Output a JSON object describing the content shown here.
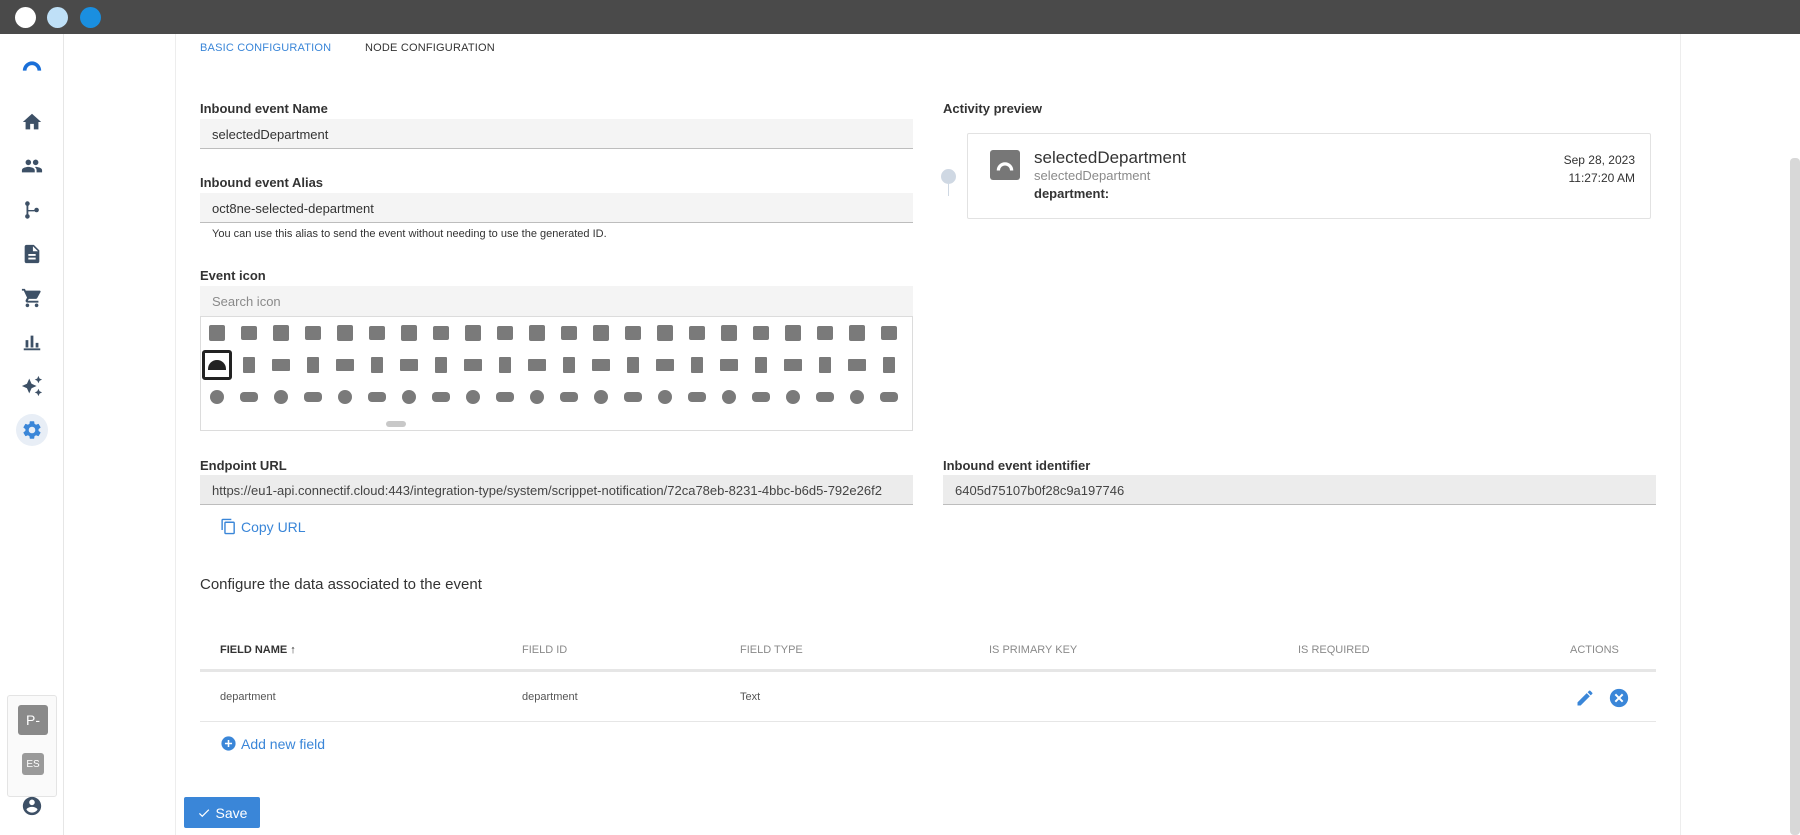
{
  "tabs": [
    {
      "label": "BASIC CONFIGURATION",
      "active": true
    },
    {
      "label": "NODE CONFIGURATION",
      "active": false
    }
  ],
  "sidebar": {
    "items": [
      {
        "icon": "home-icon"
      },
      {
        "icon": "people-icon"
      },
      {
        "icon": "workflow-icon"
      },
      {
        "icon": "document-icon"
      },
      {
        "icon": "cart-icon"
      },
      {
        "icon": "bar-chart-icon"
      },
      {
        "icon": "sparkles-icon"
      },
      {
        "icon": "gear-icon",
        "active": true
      }
    ],
    "workspace_badge": "P-",
    "language_badge": "ES",
    "account_icon": "account-circle-icon"
  },
  "form": {
    "name_label": "Inbound event Name",
    "name_value": "selectedDepartment",
    "alias_label": "Inbound event Alias",
    "alias_value": "oct8ne-selected-department",
    "alias_hint": "You can use this alias to send the event without needing to use the generated ID.",
    "icon_label": "Event icon",
    "icon_search_placeholder": "Search icon",
    "endpoint_label": "Endpoint URL",
    "endpoint_value": "https://eu1-api.connectif.cloud:443/integration-type/system/scrippet-notification/72ca78eb-8231-4bbc-b6d5-792e26f2",
    "copy_url_label": "Copy URL",
    "identifier_label": "Inbound event identifier",
    "identifier_value": "6405d75107b0f28c9a197746"
  },
  "preview": {
    "label": "Activity preview",
    "title": "selectedDepartment",
    "subtitle": "selectedDepartment",
    "field_label": "department:",
    "date": "Sep 28, 2023",
    "time": "11:27:20 AM"
  },
  "data_section": {
    "title": "Configure the data associated to the event",
    "columns": [
      "FIELD NAME",
      "FIELD ID",
      "FIELD TYPE",
      "IS PRIMARY KEY",
      "IS REQUIRED",
      "ACTIONS"
    ],
    "rows": [
      {
        "field_name": "department",
        "field_id": "department",
        "field_type": "Text"
      }
    ],
    "add_field_label": "Add new field"
  },
  "save_label": "Save",
  "colors": {
    "accent": "#3a86d8",
    "titlebar": "#4a4a4a"
  }
}
